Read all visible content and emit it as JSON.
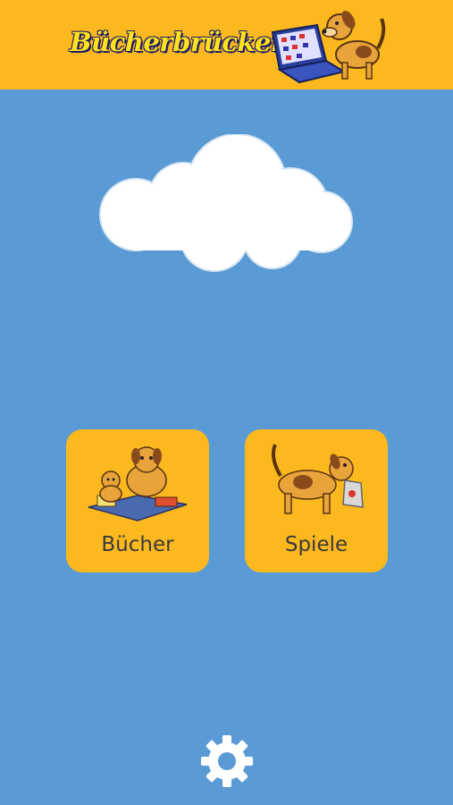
{
  "header": {
    "logo_text": "Bücherbrücken",
    "background": "#fbb81f"
  },
  "background": "#5b9bd5",
  "menu": {
    "tiles": [
      {
        "label": "Bücher",
        "icon": "dog-with-books-illustration"
      },
      {
        "label": "Spiele",
        "icon": "dog-carrying-bag-illustration"
      }
    ]
  },
  "footer": {
    "icon": "gear-icon"
  }
}
